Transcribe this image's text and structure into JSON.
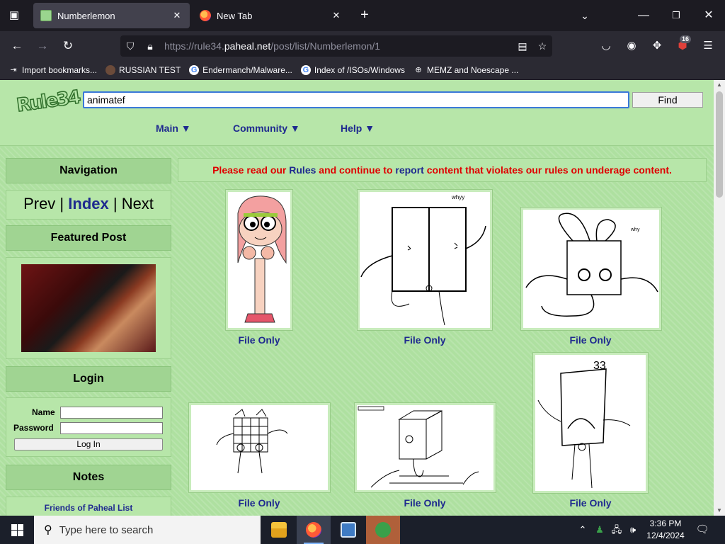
{
  "browser": {
    "tabs": [
      {
        "title": "Numberlemon",
        "active": true
      },
      {
        "title": "New Tab",
        "active": false
      }
    ],
    "url_prefix": "https://rule34.",
    "url_domain": "paheal.net",
    "url_path": "/post/list/Numberlemon/1",
    "extension_badge": "16",
    "bookmarks": [
      {
        "label": "Import bookmarks...",
        "icon": "import-icon"
      },
      {
        "label": "RUSSIAN TEST",
        "icon": "russian-favicon"
      },
      {
        "label": "Endermanch/Malware...",
        "icon": "google-favicon"
      },
      {
        "label": "Index of /ISOs/Windows",
        "icon": "google-favicon"
      },
      {
        "label": "MEMZ and Noescape ...",
        "icon": "globe-icon"
      }
    ]
  },
  "site": {
    "logo": "Rule34",
    "search_value": "animatef",
    "find_label": "Find",
    "menu": {
      "main": "Main ▼",
      "community": "Community ▼",
      "help": "Help ▼"
    },
    "notice": {
      "part1": "Please read our ",
      "rules": "Rules",
      "part2": " and continue to ",
      "report": "report",
      "part3": " content that violates our rules on underage content."
    }
  },
  "sidebar": {
    "navigation": {
      "title": "Navigation",
      "prev": "Prev",
      "sep1": " | ",
      "index": "Index",
      "sep2": " | ",
      "next": "Next"
    },
    "featured": {
      "title": "Featured Post"
    },
    "login": {
      "title": "Login",
      "name_label": "Name",
      "password_label": "Password",
      "button": "Log In"
    },
    "notes": {
      "title": "Notes",
      "friends": "Friends of Paheal List"
    }
  },
  "posts": [
    {
      "caption": "File Only",
      "scribble": "whyy"
    },
    {
      "caption": "File Only",
      "scribble": "why"
    },
    {
      "caption": "File Only"
    },
    {
      "caption": "File Only"
    },
    {
      "caption": "File Only"
    },
    {
      "caption": "File Only",
      "scribble": "33"
    }
  ],
  "taskbar": {
    "search_placeholder": "Type here to search",
    "time": "3:36 PM",
    "date": "12/4/2024"
  }
}
